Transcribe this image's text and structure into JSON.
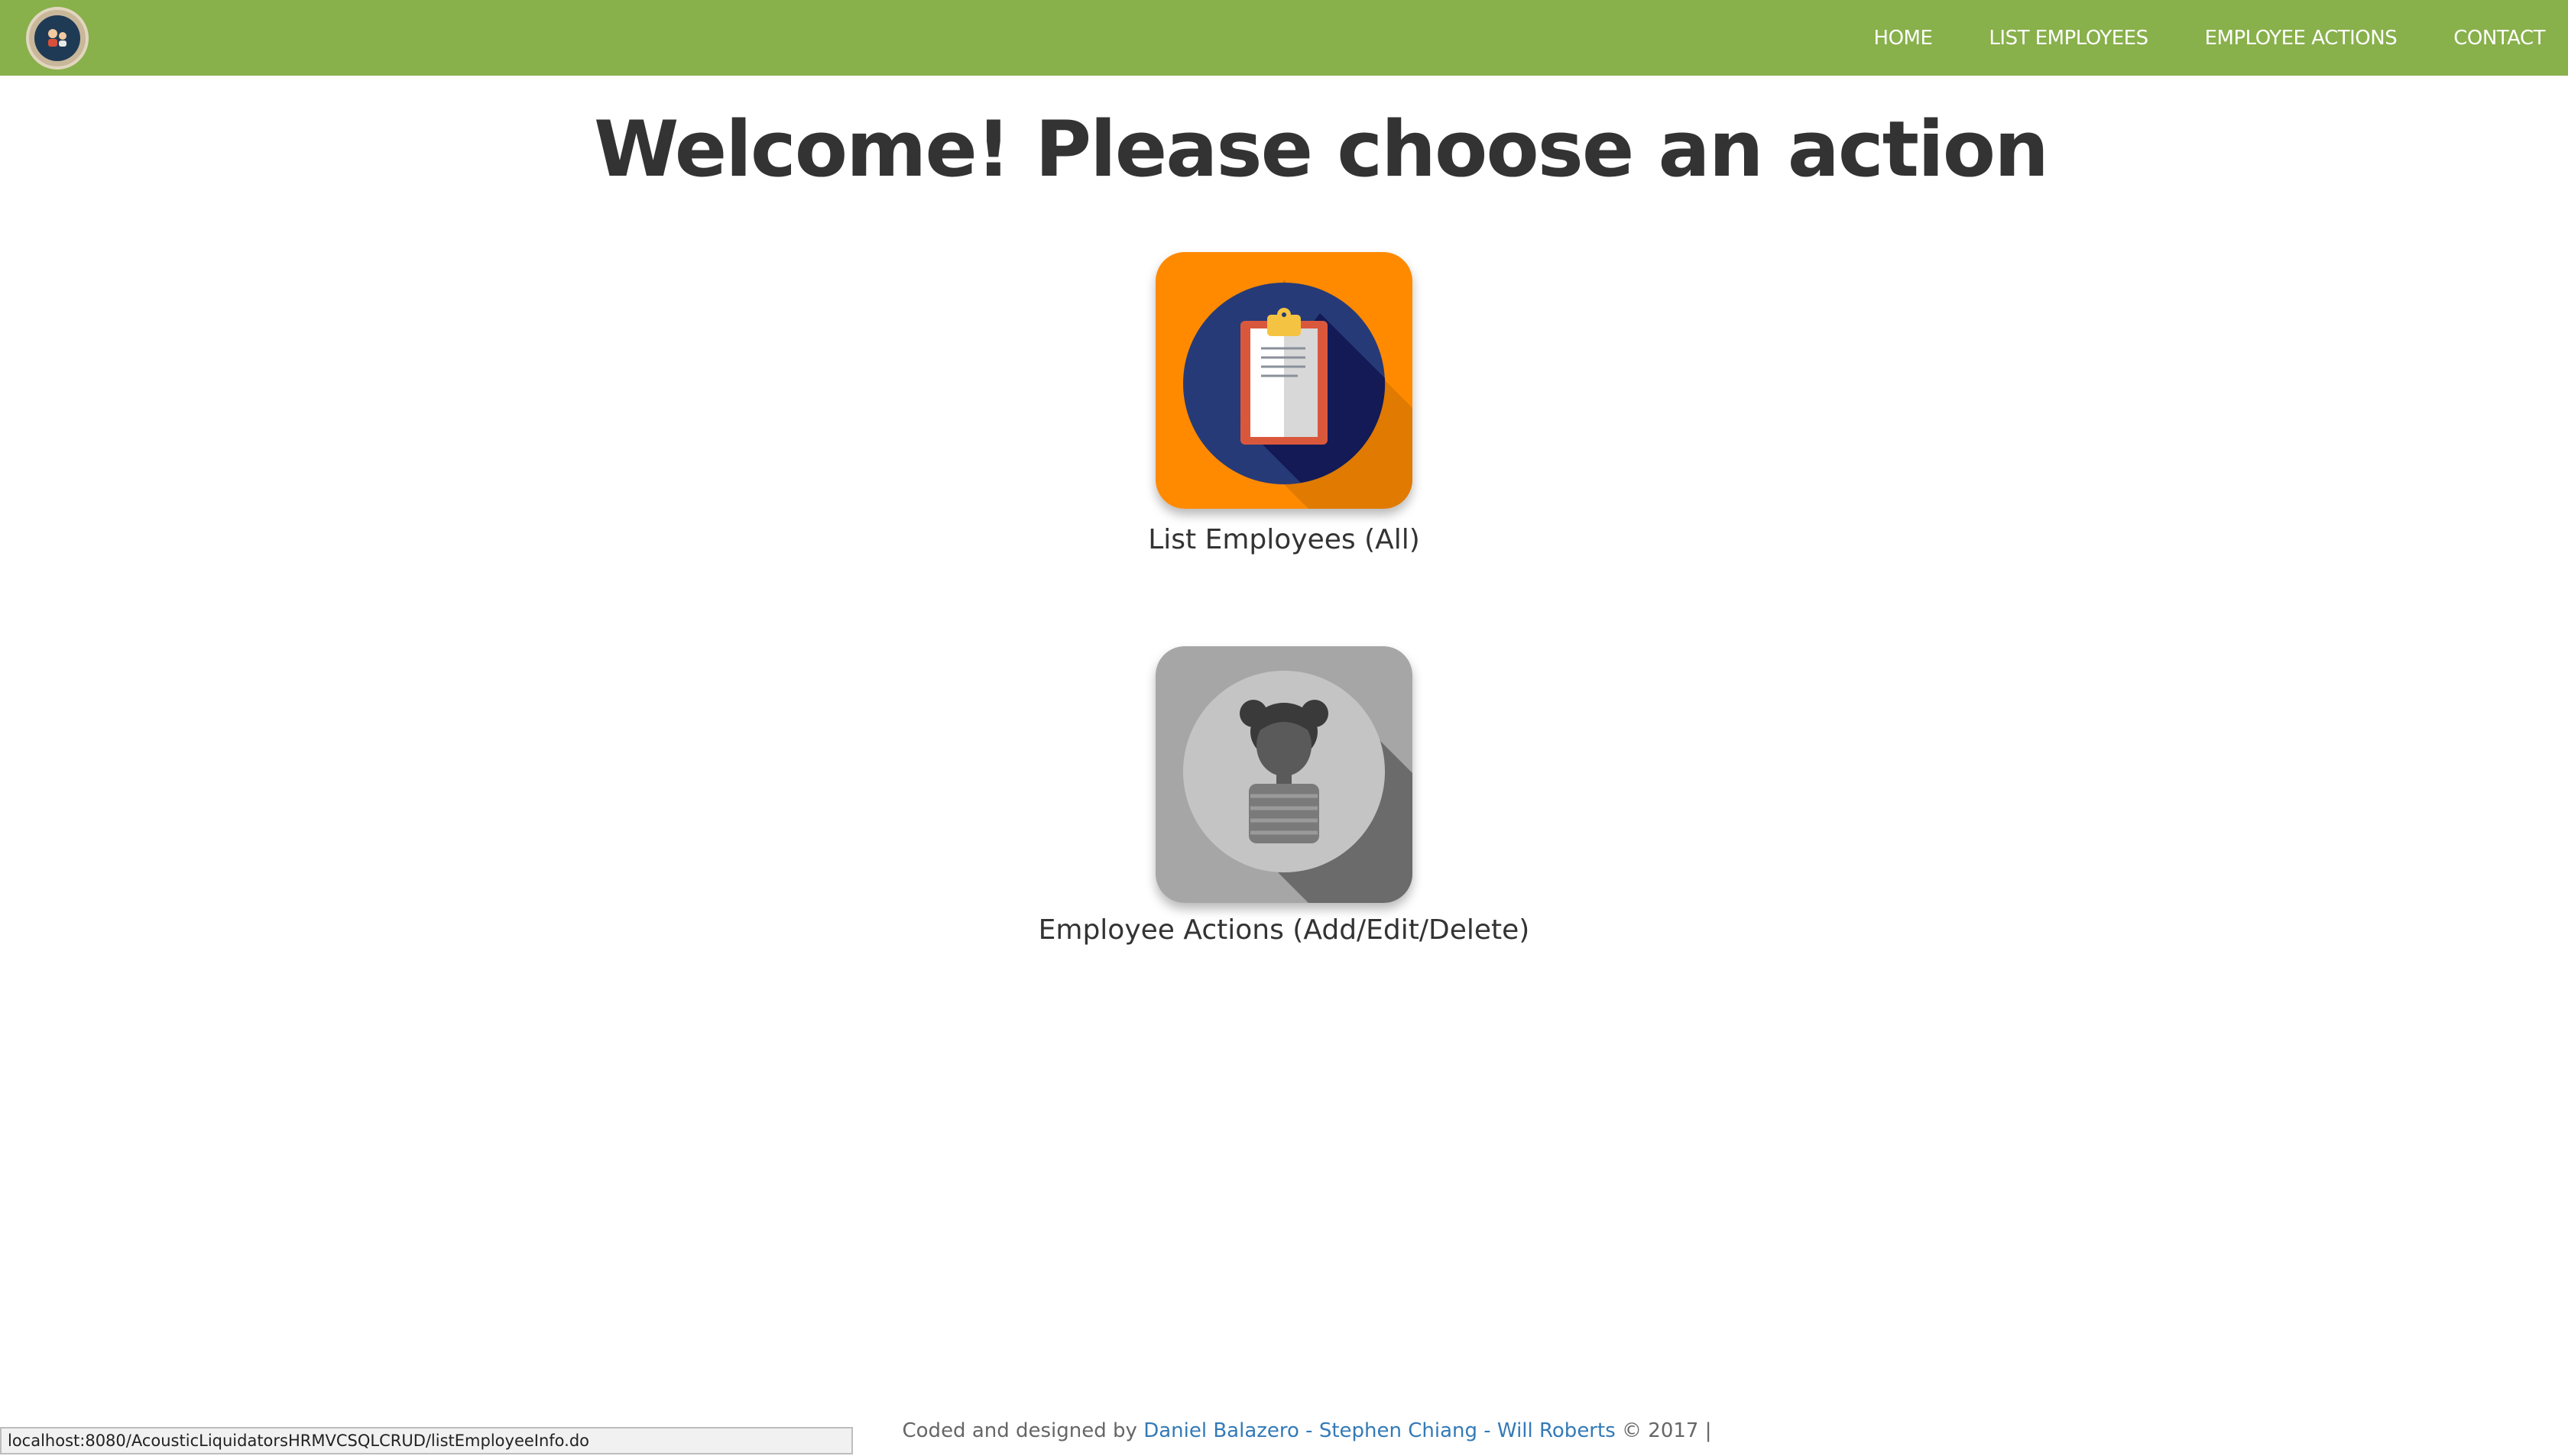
{
  "nav": {
    "links": [
      "HOME",
      "LIST EMPLOYEES",
      "EMPLOYEE ACTIONS",
      "CONTACT"
    ]
  },
  "main": {
    "headline": "Welcome! Please choose an action",
    "actions": [
      {
        "label": "List Employees (All)",
        "icon": "clipboard-icon"
      },
      {
        "label": "Employee Actions (Add/Edit/Delete)",
        "icon": "employee-avatar-icon"
      }
    ]
  },
  "footer": {
    "prefix": "Coded and designed by",
    "authors_link": "Daniel Balazero - Stephen Chiang - Will Roberts",
    "suffix": "© 2017",
    "separator": "|"
  },
  "browser": {
    "status_url": "localhost:8080/AcousticLiquidatorsHRMVCSQLCRUD/listEmployeeInfo.do"
  },
  "colors": {
    "navbar": "#88b04b",
    "list_tile": "#ff8a00",
    "list_tile_circle": "#263a78",
    "actions_tile": "#a6a6a6",
    "headline": "#333333",
    "link": "#337ab7"
  }
}
